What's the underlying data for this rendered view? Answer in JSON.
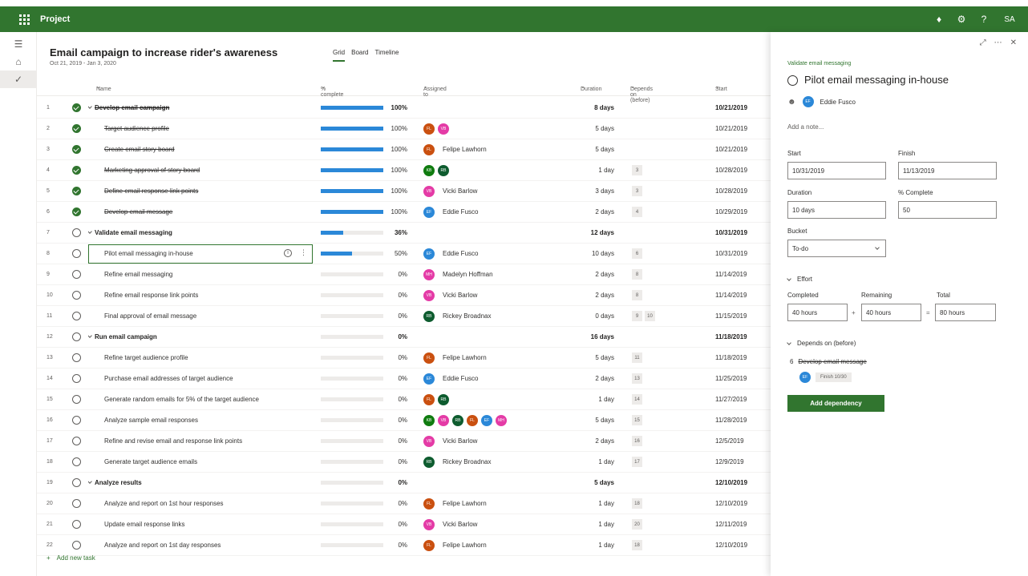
{
  "app": {
    "title": "Project",
    "user_initials": "SA"
  },
  "plan": {
    "title": "Email campaign to increase rider's awareness",
    "dates": "Oct 21, 2019 - Jan 3, 2020"
  },
  "views": [
    {
      "label": "Grid"
    },
    {
      "label": "Board"
    },
    {
      "label": "Timeline"
    }
  ],
  "columns": {
    "name": "Name",
    "pct": "% complete",
    "assigned": "Assigned to",
    "duration": "Duration",
    "depends": "Depends on (before)",
    "start": "Start"
  },
  "colors": {
    "brand": "#31752f",
    "bar": "#2b88d8",
    "FL": "#ca5010",
    "VB": "#e43ba6",
    "KB": "#107c10",
    "RB": "#0e5c2f",
    "EF": "#2b88d8",
    "MH": "#e43ba6"
  },
  "rows": [
    {
      "num": "1",
      "name": "Develop email campaign",
      "type": "summary",
      "done": true,
      "pct": 100,
      "pct_label": "100%",
      "avatars": [],
      "assignee": "",
      "duration": "8 days",
      "deps": [],
      "start": "10/21/2019"
    },
    {
      "num": "2",
      "name": "Target audience profile",
      "type": "child",
      "done": true,
      "pct": 100,
      "pct_label": "100%",
      "avatars": [
        "FL",
        "VB"
      ],
      "assignee": "",
      "duration": "5 days",
      "deps": [],
      "start": "10/21/2019"
    },
    {
      "num": "3",
      "name": "Create email story board",
      "type": "child",
      "done": true,
      "pct": 100,
      "pct_label": "100%",
      "avatars": [
        "FL"
      ],
      "assignee": "Felipe Lawhorn",
      "duration": "5 days",
      "deps": [],
      "start": "10/21/2019"
    },
    {
      "num": "4",
      "name": "Marketing approval of story board",
      "type": "child",
      "done": true,
      "pct": 100,
      "pct_label": "100%",
      "avatars": [
        "KB",
        "RB"
      ],
      "assignee": "",
      "duration": "1 day",
      "deps": [
        "3"
      ],
      "start": "10/28/2019"
    },
    {
      "num": "5",
      "name": "Define email response link points",
      "type": "child",
      "done": true,
      "pct": 100,
      "pct_label": "100%",
      "avatars": [
        "VB"
      ],
      "assignee": "Vicki Barlow",
      "duration": "3 days",
      "deps": [
        "3"
      ],
      "start": "10/28/2019"
    },
    {
      "num": "6",
      "name": "Develop email message",
      "type": "child",
      "done": true,
      "pct": 100,
      "pct_label": "100%",
      "avatars": [
        "EF"
      ],
      "assignee": "Eddie Fusco",
      "duration": "2 days",
      "deps": [
        "4"
      ],
      "start": "10/29/2019"
    },
    {
      "num": "7",
      "name": "Validate email messaging",
      "type": "summary",
      "done": false,
      "pct": 36,
      "pct_label": "36%",
      "avatars": [],
      "assignee": "",
      "duration": "12 days",
      "deps": [],
      "start": "10/31/2019"
    },
    {
      "num": "8",
      "name": "Pilot email messaging in-house",
      "type": "selected",
      "done": false,
      "pct": 50,
      "pct_label": "50%",
      "avatars": [
        "EF"
      ],
      "assignee": "Eddie Fusco",
      "duration": "10 days",
      "deps": [
        "6"
      ],
      "start": "10/31/2019"
    },
    {
      "num": "9",
      "name": "Refine email messaging",
      "type": "child",
      "done": false,
      "pct": 0,
      "pct_label": "0%",
      "avatars": [
        "MH"
      ],
      "assignee": "Madelyn Hoffman",
      "duration": "2 days",
      "deps": [
        "8"
      ],
      "start": "11/14/2019"
    },
    {
      "num": "10",
      "name": "Refine email response link points",
      "type": "child",
      "done": false,
      "pct": 0,
      "pct_label": "0%",
      "avatars": [
        "VB"
      ],
      "assignee": "Vicki Barlow",
      "duration": "2 days",
      "deps": [
        "8"
      ],
      "start": "11/14/2019"
    },
    {
      "num": "11",
      "name": "Final approval of email message",
      "type": "child",
      "done": false,
      "pct": 0,
      "pct_label": "0%",
      "avatars": [
        "RB"
      ],
      "assignee": "Rickey Broadnax",
      "duration": "0 days",
      "deps": [
        "9",
        "10"
      ],
      "start": "11/15/2019"
    },
    {
      "num": "12",
      "name": "Run email campaign",
      "type": "summary",
      "done": false,
      "pct": 0,
      "pct_label": "0%",
      "avatars": [],
      "assignee": "",
      "duration": "16 days",
      "deps": [],
      "start": "11/18/2019"
    },
    {
      "num": "13",
      "name": "Refine target audience profile",
      "type": "child",
      "done": false,
      "pct": 0,
      "pct_label": "0%",
      "avatars": [
        "FL"
      ],
      "assignee": "Felipe Lawhorn",
      "duration": "5 days",
      "deps": [
        "11"
      ],
      "start": "11/18/2019"
    },
    {
      "num": "14",
      "name": "Purchase email addresses of target audience",
      "type": "child",
      "done": false,
      "pct": 0,
      "pct_label": "0%",
      "avatars": [
        "EF"
      ],
      "assignee": "Eddie Fusco",
      "duration": "2 days",
      "deps": [
        "13"
      ],
      "start": "11/25/2019"
    },
    {
      "num": "15",
      "name": "Generate random emails for 5% of the target audience",
      "type": "child",
      "done": false,
      "pct": 0,
      "pct_label": "0%",
      "avatars": [
        "FL",
        "RB"
      ],
      "assignee": "",
      "duration": "1 day",
      "deps": [
        "14"
      ],
      "start": "11/27/2019"
    },
    {
      "num": "16",
      "name": "Analyze sample email responses",
      "type": "child",
      "done": false,
      "pct": 0,
      "pct_label": "0%",
      "avatars": [
        "KB",
        "VB",
        "RB",
        "FL",
        "EF",
        "MH"
      ],
      "assignee": "",
      "duration": "5 days",
      "deps": [
        "15"
      ],
      "start": "11/28/2019"
    },
    {
      "num": "17",
      "name": "Refine and revise email and response link points",
      "type": "child",
      "done": false,
      "pct": 0,
      "pct_label": "0%",
      "avatars": [
        "VB"
      ],
      "assignee": "Vicki Barlow",
      "duration": "2 days",
      "deps": [
        "16"
      ],
      "start": "12/5/2019"
    },
    {
      "num": "18",
      "name": "Generate target audience emails",
      "type": "child",
      "done": false,
      "pct": 0,
      "pct_label": "0%",
      "avatars": [
        "RB"
      ],
      "assignee": "Rickey Broadnax",
      "duration": "1 day",
      "deps": [
        "17"
      ],
      "start": "12/9/2019"
    },
    {
      "num": "19",
      "name": "Analyze results",
      "type": "summary",
      "done": false,
      "pct": 0,
      "pct_label": "0%",
      "avatars": [],
      "assignee": "",
      "duration": "5 days",
      "deps": [],
      "start": "12/10/2019"
    },
    {
      "num": "20",
      "name": "Analyze and report on 1st hour responses",
      "type": "child",
      "done": false,
      "pct": 0,
      "pct_label": "0%",
      "avatars": [
        "FL"
      ],
      "assignee": "Felipe Lawhorn",
      "duration": "1 day",
      "deps": [
        "18"
      ],
      "start": "12/10/2019"
    },
    {
      "num": "21",
      "name": "Update email response links",
      "type": "child",
      "done": false,
      "pct": 0,
      "pct_label": "0%",
      "avatars": [
        "VB"
      ],
      "assignee": "Vicki Barlow",
      "duration": "1 day",
      "deps": [
        "20"
      ],
      "start": "12/11/2019"
    },
    {
      "num": "22",
      "name": "Analyze and report on 1st day responses",
      "type": "child",
      "done": false,
      "pct": 0,
      "pct_label": "0%",
      "avatars": [
        "FL"
      ],
      "assignee": "Felipe Lawhorn",
      "duration": "1 day",
      "deps": [
        "18"
      ],
      "start": "12/10/2019"
    }
  ],
  "add_task_label": "Add new task",
  "panel": {
    "bucket_label": "Validate email messaging",
    "task_title": "Pilot email messaging in-house",
    "assignee_initials": "EF",
    "assignee_name": "Eddie Fusco",
    "note_placeholder": "Add a note...",
    "start_label": "Start",
    "start_value": "10/31/2019",
    "finish_label": "Finish",
    "finish_value": "11/13/2019",
    "duration_label": "Duration",
    "duration_value": "10 days",
    "pct_label": "% Complete",
    "pct_value": "50",
    "bucket_field_label": "Bucket",
    "bucket_value": "To-do",
    "effort_label": "Effort",
    "completed_label": "Completed",
    "completed_value": "40 hours",
    "remaining_label": "Remaining",
    "remaining_value": "40 hours",
    "total_label": "Total",
    "total_value": "80 hours",
    "plus": "+",
    "equals": "=",
    "depends_label": "Depends on (before)",
    "dep_num": "6",
    "dep_name": "Develop email message",
    "dep_initials": "EF",
    "dep_finish": "Finish 10/30",
    "add_dependency_label": "Add dependency"
  }
}
